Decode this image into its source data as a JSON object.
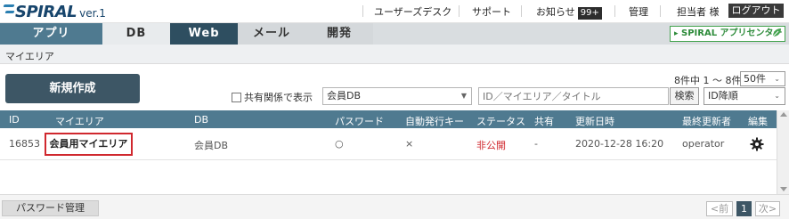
{
  "header": {
    "logo_text": "SPIRAL",
    "logo_version": "ver.1",
    "nav": {
      "user_desk": "ユーザーズデスク",
      "support": "サポート",
      "news": "お知らせ",
      "news_badge": "99+",
      "admin": "管理",
      "user": "担当者 様",
      "logout": "ログアウト"
    }
  },
  "tabs": [
    {
      "label": "アプリ"
    },
    {
      "label": "DB"
    },
    {
      "label": "Web"
    },
    {
      "label": "メール"
    },
    {
      "label": "開発"
    }
  ],
  "appcenter_label": "SPIRAL アプリセンター",
  "breadcrumb": "マイエリア",
  "toolbar": {
    "new_button": "新規作成",
    "shared_label": "共有関係で表示",
    "db_select": "会員DB",
    "search_placeholder": "ID／マイエリア／タイトル",
    "search_button": "検索",
    "sort_select": "ID降順",
    "count_text": "8件中 1 ～ 8件",
    "per_page": "50件"
  },
  "table": {
    "headers": [
      "ID",
      "マイエリア",
      "DB",
      "パスワード",
      "自動発行キー",
      "ステータス",
      "共有",
      "更新日時",
      "最終更新者",
      "編集"
    ],
    "rows": [
      {
        "id": "16853",
        "name": "会員用マイエリア",
        "db": "会員DB",
        "password": "○",
        "auto_key": "×",
        "status": "非公開",
        "shared": "-",
        "updated": "2020-12-28 16:20",
        "updated_by": "operator"
      }
    ]
  },
  "footer": {
    "password_button": "パスワード管理",
    "prev": "<前",
    "page": "1",
    "next": "次>"
  },
  "colors": {
    "tab_active": "#2e4e60",
    "tab_apps": "#4f7a90",
    "table_header": "#4f7a90",
    "status_red": "#d0282e",
    "appcenter_green": "#44a34f"
  }
}
